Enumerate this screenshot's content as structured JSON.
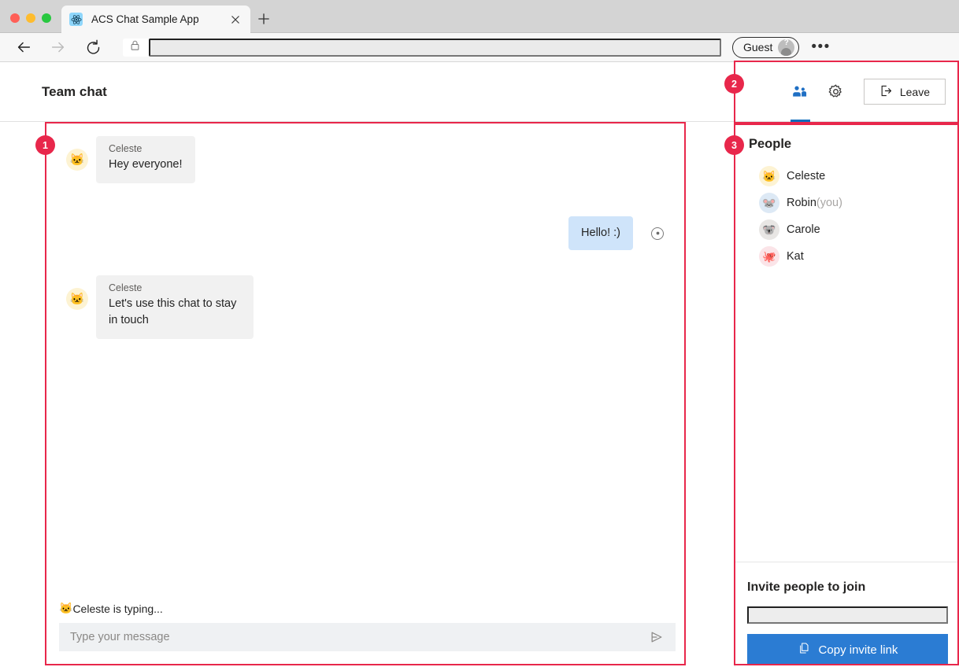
{
  "browser": {
    "tab": {
      "title": "ACS Chat Sample App",
      "favicon": "react-logo-icon",
      "close_icon": "close-icon"
    },
    "new_tab_icon": "plus-icon",
    "back_icon": "back-arrow-icon",
    "forward_icon": "forward-arrow-icon",
    "reload_icon": "reload-icon",
    "lock_icon": "lock-icon",
    "address_value": "",
    "profile": {
      "label": "Guest",
      "avatar_icon": "guest-avatar-icon"
    },
    "menu_icon": "ellipsis-icon"
  },
  "app": {
    "chat_title": "Team chat",
    "toolbar": {
      "people_tab_icon": "people-icon",
      "settings_icon": "gear-icon",
      "leave_label": "Leave",
      "leave_icon": "sign-out-icon"
    },
    "messages": [
      {
        "sender": "Celeste",
        "text": "Hey everyone!",
        "avatar": "🐱",
        "avatar_class": "av-cat",
        "direction": "in"
      },
      {
        "sender": "",
        "text": "Hello! :)",
        "avatar": "",
        "avatar_class": "",
        "direction": "out",
        "status_icon": "seen-icon"
      },
      {
        "sender": "Celeste",
        "text": "Let's use this chat to stay in touch",
        "avatar": "🐱",
        "avatar_class": "av-cat",
        "direction": "in"
      }
    ],
    "typing_indicator": {
      "avatar": "🐱",
      "text": "Celeste is typing..."
    },
    "composer": {
      "placeholder": "Type your message",
      "value": "",
      "send_icon": "send-icon"
    },
    "people": {
      "title": "People",
      "members": [
        {
          "name": "Celeste",
          "suffix": "",
          "avatar": "🐱",
          "avatar_class": "av-cat"
        },
        {
          "name": "Robin",
          "suffix": "(you)",
          "avatar": "🐭",
          "avatar_class": "av-mouse"
        },
        {
          "name": "Carole",
          "suffix": "",
          "avatar": "🐨",
          "avatar_class": "av-koala"
        },
        {
          "name": "Kat",
          "suffix": "",
          "avatar": "🐙",
          "avatar_class": "av-octopus"
        }
      ]
    },
    "invite": {
      "title": "Invite people to join",
      "link_value": "",
      "copy_label": "Copy invite link",
      "copy_icon": "copy-icon"
    }
  },
  "annotations": [
    {
      "number": "1",
      "target": "chat-area"
    },
    {
      "number": "2",
      "target": "panel-toolbar"
    },
    {
      "number": "3",
      "target": "people-panel"
    }
  ],
  "colors": {
    "annotation": "#e8274b",
    "accent_blue": "#0f6cbd",
    "button_blue": "#2b7cd3",
    "outgoing_bubble": "#cfe4fa",
    "incoming_bubble": "#f1f1f1"
  }
}
